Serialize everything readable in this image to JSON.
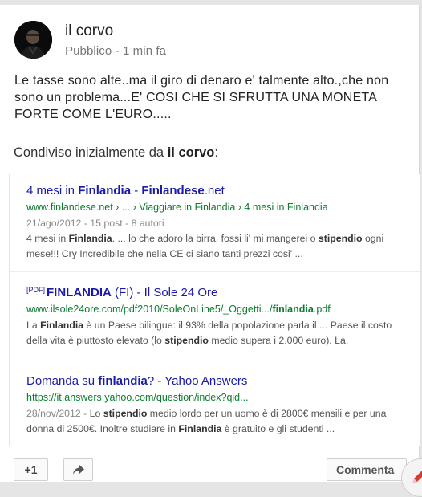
{
  "post": {
    "author": "il corvo",
    "meta": "Pubblico - 1 min fa",
    "text": "Le tasse sono alte..ma il giro di denaro e' talmente alto.,che non sono un problema...E' COSI CHE SI SFRUTTA UNA MONETA FORTE COME L'EURO....."
  },
  "shared": {
    "prefix": "Condiviso inizialmente da ",
    "author": "il corvo",
    "suffix": ":"
  },
  "results": [
    {
      "title_parts": [
        "4 mesi in ",
        "Finlandia",
        " - ",
        "Finlandese",
        ".net"
      ],
      "url_parts": [
        "www.finlandese.net › ... › Viaggiare in Finlandia › 4 mesi in Finlandia"
      ],
      "date": "21/ago/2012 - 15 post - 8 autori",
      "snippet": [
        "4 mesi in ",
        "Finlandia",
        ". ... lo che adoro la birra, fossi li' mi mangerei o ",
        "stipendio",
        " ogni mese!!! Cry Incredibile che nella CE ci siano tanti prezzi cosi' ..."
      ]
    },
    {
      "pdf": "[PDF]",
      "title_parts": [
        "FINLANDIA",
        " (FI) - Il Sole 24 Ore"
      ],
      "url_parts": [
        "www.ilsole24ore.com/pdf2010/SoleOnLine5/_Oggetti.../",
        "finlandia",
        ".pdf"
      ],
      "snippet": [
        "La ",
        "Finlandia",
        " è un Paese bilingue: il 93% della popolazione parla il ... Paese il costo della vita è piuttosto elevato (lo ",
        "stipendio",
        " medio supera i 2.000 euro). La."
      ]
    },
    {
      "title_parts": [
        "Domanda su ",
        "finlandia",
        "? - Yahoo Answers"
      ],
      "url_parts": [
        "https://it.answers.yahoo.com/question/index?qid..."
      ],
      "date": "28/nov/2012 - ",
      "snippet": [
        "Lo ",
        "stipendio",
        " medio lordo per un uomo è di 2800€ mensili e per una donna di 2500€. Inoltre studiare in ",
        "Finlandia",
        " è gratuito e gli studenti ..."
      ]
    }
  ],
  "actions": {
    "plus_one": "+1",
    "comment": "Commenta"
  },
  "icons": {
    "share": "share-arrow-icon",
    "edit": "pencil-icon",
    "accent": "#d23f31"
  }
}
